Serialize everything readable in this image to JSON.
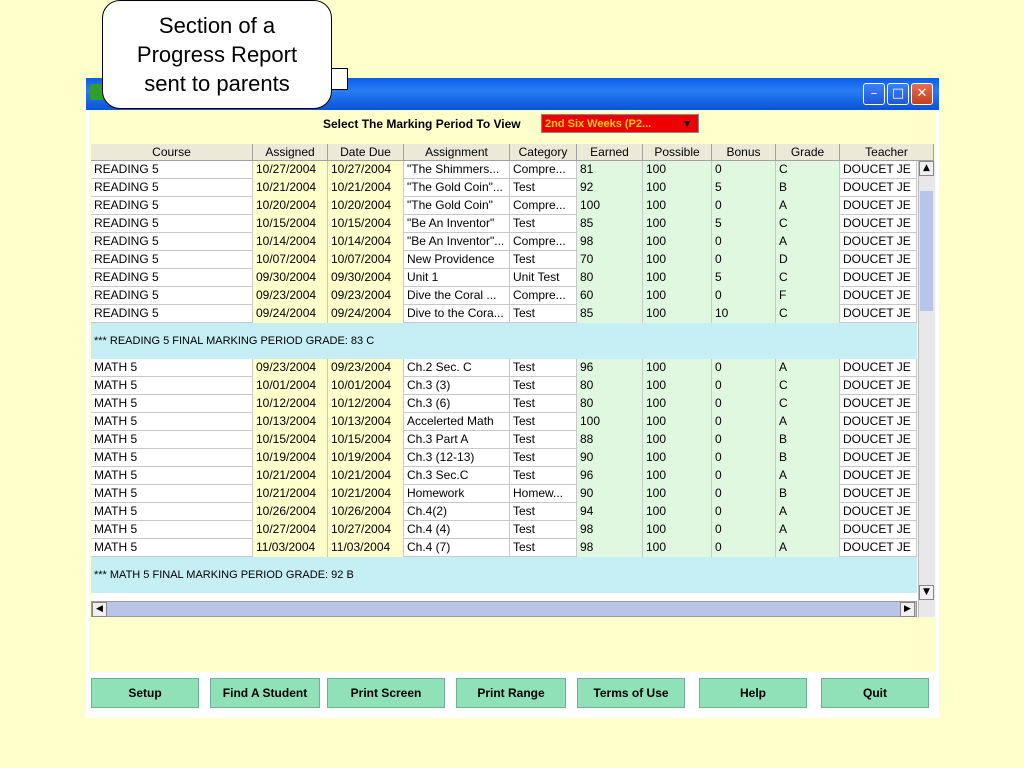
{
  "callout_text": [
    "Section of a",
    "Progress Report",
    "sent to parents"
  ],
  "window": {
    "controls": [
      "minimize-icon",
      "maximize-icon",
      "close-icon"
    ]
  },
  "selector": {
    "label": "Select The Marking Period To View",
    "value": "2nd Six Weeks (P2..."
  },
  "columns": [
    "Course",
    "Assigned",
    "Date Due",
    "Assignment",
    "Category",
    "Earned",
    "Possible",
    "Bonus",
    "Grade",
    "Teacher"
  ],
  "reading_rows": [
    [
      "READING 5",
      "10/27/2004",
      "10/27/2004",
      "\"The Shimmers...",
      "Compre...",
      "81",
      "100",
      "0",
      "C",
      "DOUCET JE"
    ],
    [
      "READING 5",
      "10/21/2004",
      "10/21/2004",
      "\"The Gold Coin\"...",
      "Test",
      "92",
      "100",
      "5",
      "B",
      "DOUCET JE"
    ],
    [
      "READING 5",
      "10/20/2004",
      "10/20/2004",
      "\"The Gold Coin\"",
      "Compre...",
      "100",
      "100",
      "0",
      "A",
      "DOUCET JE"
    ],
    [
      "READING 5",
      "10/15/2004",
      "10/15/2004",
      "\"Be An Inventor\"",
      "Test",
      "85",
      "100",
      "5",
      "C",
      "DOUCET JE"
    ],
    [
      "READING 5",
      "10/14/2004",
      "10/14/2004",
      "\"Be An Inventor\"...",
      "Compre...",
      "98",
      "100",
      "0",
      "A",
      "DOUCET JE"
    ],
    [
      "READING 5",
      "10/07/2004",
      "10/07/2004",
      "New Providence",
      "Test",
      "70",
      "100",
      "0",
      "D",
      "DOUCET JE"
    ],
    [
      "READING 5",
      "09/30/2004",
      "09/30/2004",
      "Unit 1",
      "Unit Test",
      "80",
      "100",
      "5",
      "C",
      "DOUCET JE"
    ],
    [
      "READING 5",
      "09/23/2004",
      "09/23/2004",
      "Dive the Coral ...",
      "Compre...",
      "60",
      "100",
      "0",
      "F",
      "DOUCET JE"
    ],
    [
      "READING 5",
      "09/24/2004",
      "09/24/2004",
      "Dive to the Cora...",
      "Test",
      "85",
      "100",
      "10",
      "C",
      "DOUCET JE"
    ]
  ],
  "reading_summary": "*** READING 5 FINAL MARKING PERIOD GRADE: 83 C",
  "math_rows": [
    [
      "MATH 5",
      "09/23/2004",
      "09/23/2004",
      "Ch.2 Sec. C",
      "Test",
      "96",
      "100",
      "0",
      "A",
      "DOUCET JE"
    ],
    [
      "MATH 5",
      "10/01/2004",
      "10/01/2004",
      "Ch.3 (3)",
      "Test",
      "80",
      "100",
      "0",
      "C",
      "DOUCET JE"
    ],
    [
      "MATH 5",
      "10/12/2004",
      "10/12/2004",
      "Ch.3 (6)",
      "Test",
      "80",
      "100",
      "0",
      "C",
      "DOUCET JE"
    ],
    [
      "MATH 5",
      "10/13/2004",
      "10/13/2004",
      "Accelerted Math",
      "Test",
      "100",
      "100",
      "0",
      "A",
      "DOUCET JE"
    ],
    [
      "MATH 5",
      "10/15/2004",
      "10/15/2004",
      "Ch.3 Part A",
      "Test",
      "88",
      "100",
      "0",
      "B",
      "DOUCET JE"
    ],
    [
      "MATH 5",
      "10/19/2004",
      "10/19/2004",
      "Ch.3 (12-13)",
      "Test",
      "90",
      "100",
      "0",
      "B",
      "DOUCET JE"
    ],
    [
      "MATH 5",
      "10/21/2004",
      "10/21/2004",
      "Ch.3 Sec.C",
      "Test",
      "96",
      "100",
      "0",
      "A",
      "DOUCET JE"
    ],
    [
      "MATH 5",
      "10/21/2004",
      "10/21/2004",
      "Homework",
      "Homew...",
      "90",
      "100",
      "0",
      "B",
      "DOUCET JE"
    ],
    [
      "MATH 5",
      "10/26/2004",
      "10/26/2004",
      "Ch.4(2)",
      "Test",
      "94",
      "100",
      "0",
      "A",
      "DOUCET JE"
    ],
    [
      "MATH 5",
      "10/27/2004",
      "10/27/2004",
      "Ch.4 (4)",
      "Test",
      "98",
      "100",
      "0",
      "A",
      "DOUCET JE"
    ],
    [
      "MATH 5",
      "11/03/2004",
      "11/03/2004",
      "Ch.4 (7)",
      "Test",
      "98",
      "100",
      "0",
      "A",
      "DOUCET JE"
    ]
  ],
  "math_summary": "*** MATH 5 FINAL MARKING PERIOD GRADE: 92 B",
  "buttons": [
    "Setup",
    "Find A Student",
    "Print Screen",
    "Print Range",
    "Terms of Use",
    "Help",
    "Quit"
  ],
  "colors": {
    "date_cell": "#ffffcc",
    "score_cell": "#e0f7e0",
    "summary_row": "#c6eef5",
    "button": "#90e0b8",
    "dropdown": "#ee0000"
  }
}
